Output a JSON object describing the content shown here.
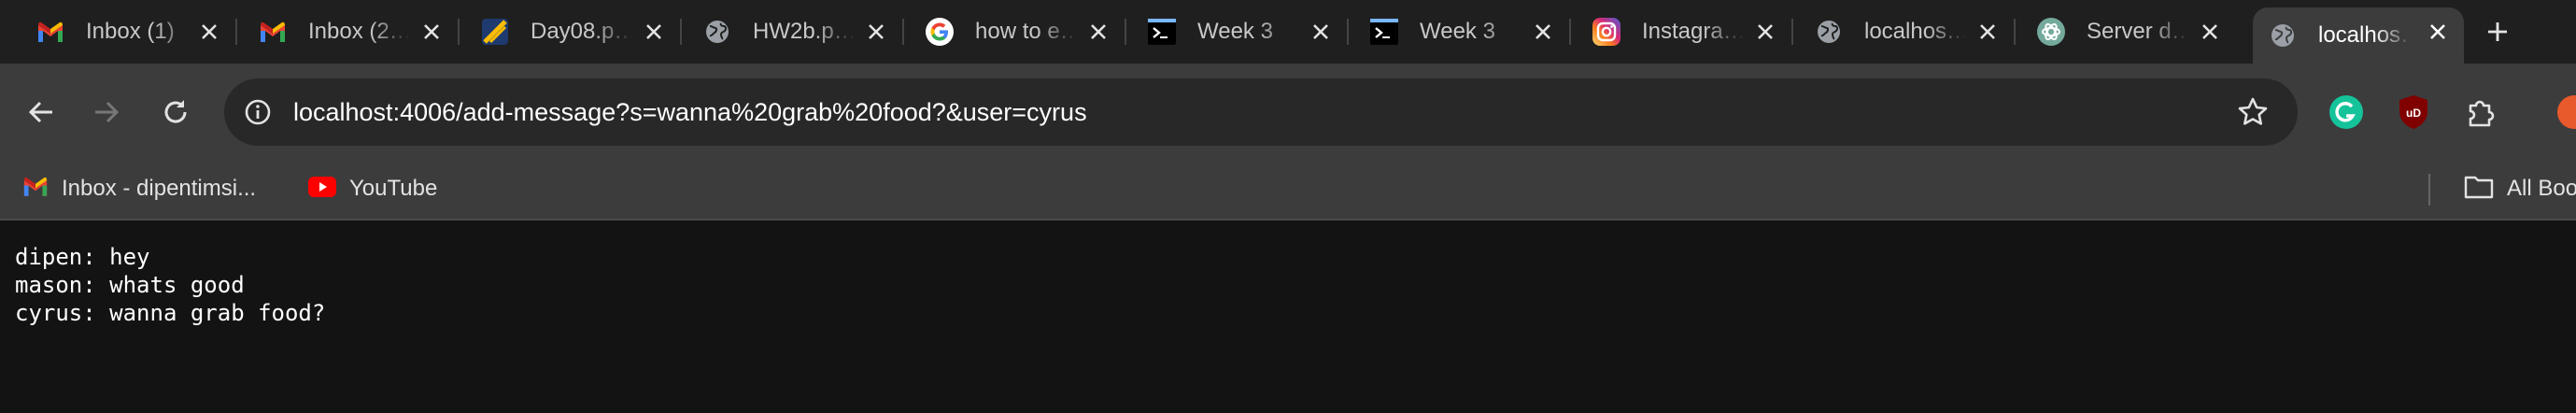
{
  "tabs": [
    {
      "title": "Inbox (1)",
      "icon": "gmail-icon"
    },
    {
      "title": "Inbox (2…",
      "icon": "gmail-icon"
    },
    {
      "title": "Day08.p…",
      "icon": "slides-icon"
    },
    {
      "title": "HW2b.p…",
      "icon": "globe-icon"
    },
    {
      "title": "how to e…",
      "icon": "google-icon"
    },
    {
      "title": "Week 3",
      "icon": "terminal-icon"
    },
    {
      "title": "Week 3",
      "icon": "terminal-icon"
    },
    {
      "title": "Instagra…",
      "icon": "instagram-icon"
    },
    {
      "title": "localhos…",
      "icon": "globe-icon"
    },
    {
      "title": "Server d…",
      "icon": "chatgpt-icon"
    },
    {
      "title": "localhos…",
      "icon": "globe-icon",
      "active": true
    }
  ],
  "toolbar": {
    "url": "localhost:4006/add-message?s=wanna%20grab%20food?&user=cyrus"
  },
  "bookmarks": {
    "items": [
      {
        "label": "Inbox - dipentimsi...",
        "icon": "gmail-icon"
      },
      {
        "label": "YouTube",
        "icon": "youtube-icon"
      }
    ],
    "all_bookmarks": "All Boo"
  },
  "page": {
    "messages": [
      "dipen: hey",
      "mason: whats good",
      "cyrus: wanna grab food?"
    ]
  },
  "colors": {
    "page_bg": "#131313",
    "chrome_bg": "#3c3c3c",
    "tabstrip_bg": "#1f1f1f",
    "omnibox_bg": "#282828"
  }
}
